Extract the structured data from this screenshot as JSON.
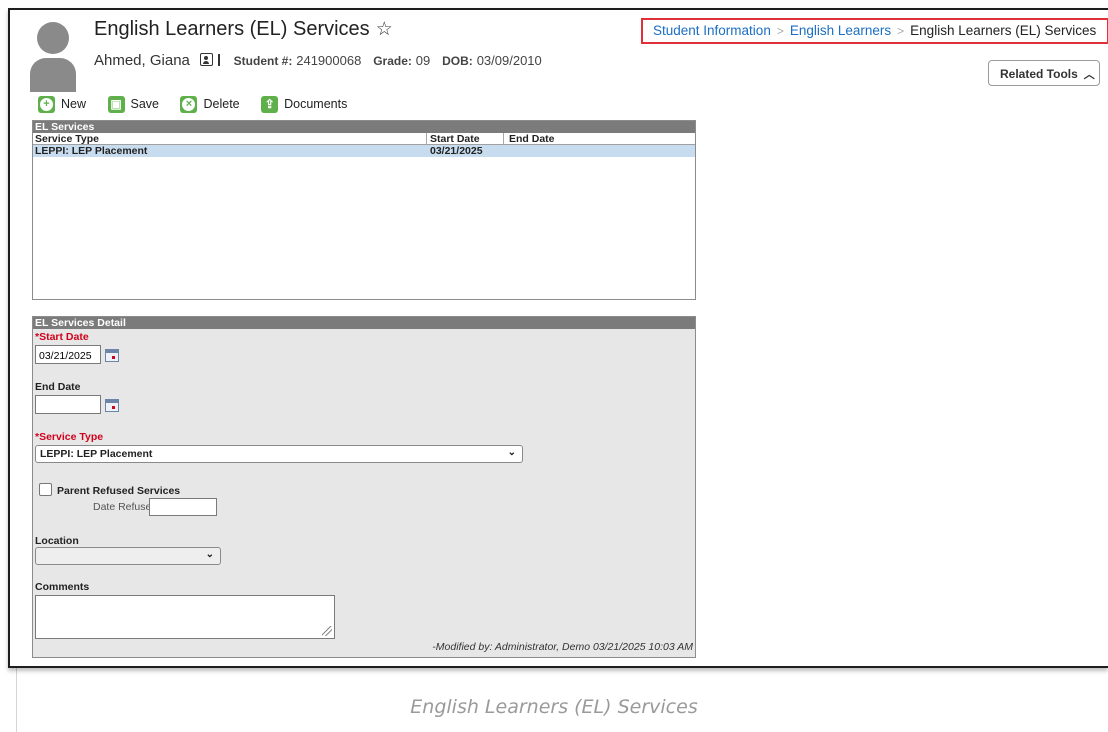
{
  "header": {
    "title": "English Learners (EL) Services",
    "student_name": "Ahmed, Giana",
    "student_num_label": "Student #:",
    "student_num": "241900068",
    "grade_label": "Grade:",
    "grade": "09",
    "dob_label": "DOB:",
    "dob": "03/09/2010"
  },
  "breadcrumb": {
    "items": [
      "Student Information",
      "English Learners",
      "English Learners (EL) Services"
    ]
  },
  "related_tools": "Related Tools",
  "toolbar": {
    "new_label": "New",
    "save_label": "Save",
    "delete_label": "Delete",
    "documents_label": "Documents"
  },
  "el_services": {
    "title": "EL Services",
    "columns": [
      "Service Type",
      "Start Date",
      "End Date"
    ],
    "rows": [
      {
        "service_type": "LEPPI: LEP Placement",
        "start_date": "03/21/2025",
        "end_date": ""
      }
    ]
  },
  "detail": {
    "title": "EL Services Detail",
    "start_date_label": "*Start Date",
    "start_date_value": "03/21/2025",
    "end_date_label": "End Date",
    "end_date_value": "",
    "service_type_label": "*Service Type",
    "service_type_value": "LEPPI: LEP Placement",
    "parent_refused_label": "Parent Refused Services",
    "parent_refused_checked": false,
    "date_refused_label": "Date Refused:",
    "date_refused_value": "",
    "location_label": "Location",
    "location_value": "",
    "comments_label": "Comments",
    "comments_value": "",
    "modified_text": "-Modified by: Administrator, Demo 03/21/2025 10:03 AM"
  },
  "caption": "English Learners (EL) Services",
  "colors": {
    "toolbar_icon": "#5fb04a",
    "link": "#1b6ec2",
    "required_label": "#d0021b",
    "highlight_border": "#e0303a",
    "selected_row": "#c7dcef",
    "panel_header": "#7b7b7b"
  }
}
